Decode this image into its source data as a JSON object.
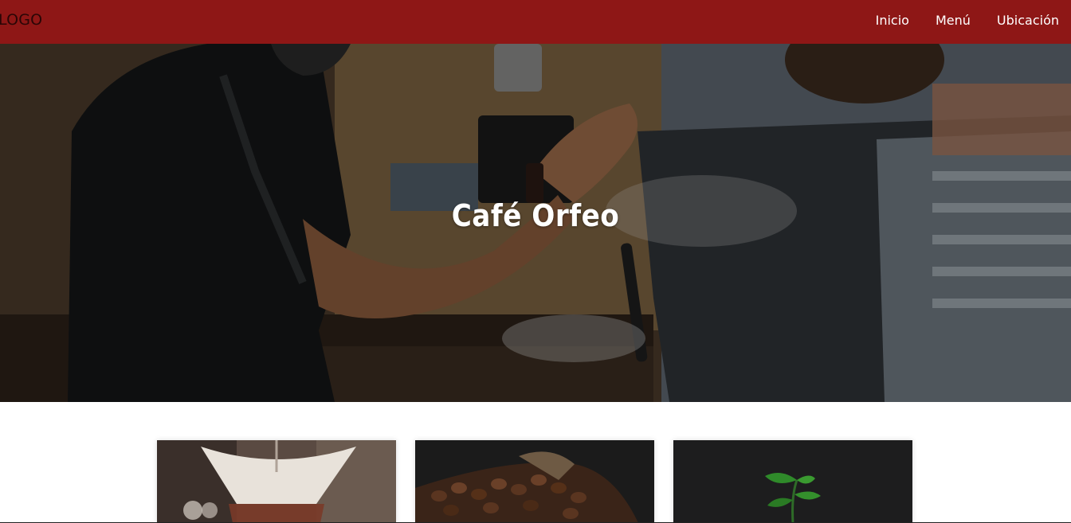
{
  "header": {
    "logo": "LOGO",
    "nav": [
      {
        "label": "Inicio"
      },
      {
        "label": "Menú"
      },
      {
        "label": "Ubicación"
      }
    ]
  },
  "hero": {
    "title": "Café Orfeo",
    "image_icon": "barista-espresso-machine-image"
  },
  "cards": [
    {
      "image_icon": "pour-over-coffee-image"
    },
    {
      "image_icon": "coffee-beans-image"
    },
    {
      "image_icon": "coffee-plant-image"
    }
  ],
  "colors": {
    "header_bg": "#8e1716",
    "nav_text": "#ffffff",
    "hero_text": "#ffffff"
  }
}
